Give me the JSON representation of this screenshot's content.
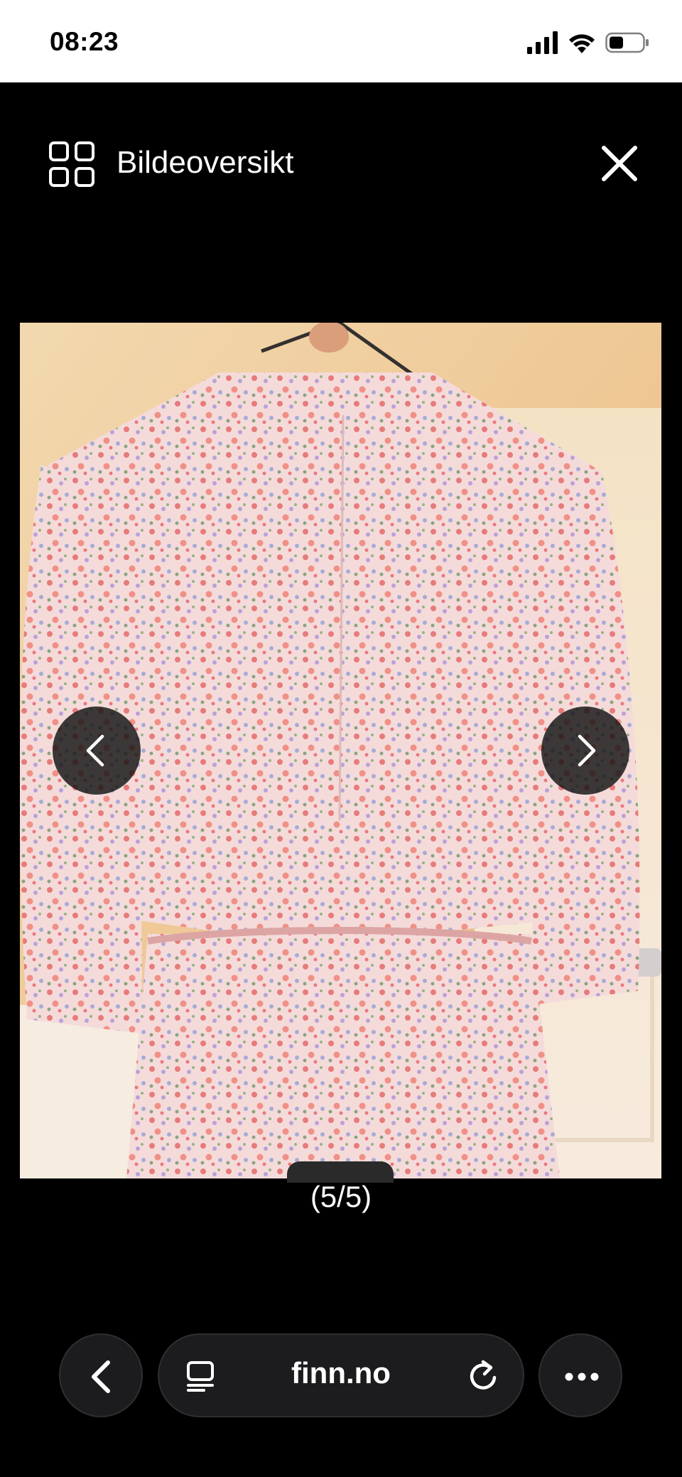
{
  "status_bar": {
    "time": "08:23"
  },
  "gallery": {
    "title": "Bildeoversikt",
    "counter": "(5/5)",
    "image_description": "floral print dress on hanger, back view"
  },
  "browser": {
    "address": "finn.no"
  },
  "icons": {
    "grid": "grid-icon",
    "close": "close-icon",
    "prev": "chevron-left-icon",
    "next": "chevron-right-icon",
    "back": "back-icon",
    "reader": "reader-mode-icon",
    "reload": "reload-icon",
    "more": "more-icon"
  },
  "colors": {
    "background": "#000000",
    "status_bar": "#ffffff",
    "control_bg": "#1c1c1e"
  }
}
